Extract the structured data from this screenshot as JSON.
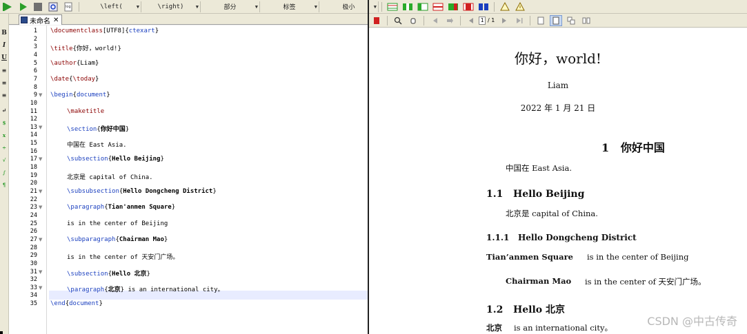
{
  "toolbar": {
    "dropdowns": [
      "\\left(",
      "\\right)",
      "部分",
      "标签",
      "极小"
    ]
  },
  "editor": {
    "tab_label": "未命名 X",
    "tab_name": "未命名",
    "lines": [
      {
        "n": "1",
        "parts": [
          [
            "cmd",
            "\\documentclass"
          ],
          [
            "",
            "[UTF8]{"
          ],
          [
            "kw",
            "ctexart"
          ],
          [
            "",
            "}"
          ]
        ]
      },
      {
        "n": "2",
        "parts": []
      },
      {
        "n": "3",
        "parts": [
          [
            "cmd",
            "\\title"
          ],
          [
            "",
            "{你好，world!}"
          ]
        ]
      },
      {
        "n": "4",
        "parts": []
      },
      {
        "n": "5",
        "parts": [
          [
            "cmd",
            "\\author"
          ],
          [
            "",
            "{Liam}"
          ]
        ]
      },
      {
        "n": "6",
        "parts": []
      },
      {
        "n": "7",
        "parts": [
          [
            "cmd",
            "\\date"
          ],
          [
            "",
            "{"
          ],
          [
            "cmd",
            "\\today"
          ],
          [
            "",
            "}"
          ]
        ]
      },
      {
        "n": "8",
        "parts": []
      },
      {
        "n": "9",
        "fold": true,
        "parts": [
          [
            "kw",
            "\\begin"
          ],
          [
            "",
            "{"
          ],
          [
            "kw",
            "document"
          ],
          [
            "",
            "}"
          ]
        ]
      },
      {
        "n": "10",
        "parts": []
      },
      {
        "n": "11",
        "ind": true,
        "parts": [
          [
            "cmd",
            "\\maketitle"
          ]
        ]
      },
      {
        "n": "12",
        "parts": []
      },
      {
        "n": "13",
        "fold": true,
        "ind": true,
        "parts": [
          [
            "kw",
            "\\section"
          ],
          [
            "",
            "{"
          ],
          [
            "bold",
            "你好中国"
          ],
          [
            "",
            "}"
          ]
        ]
      },
      {
        "n": "14",
        "parts": []
      },
      {
        "n": "15",
        "ind": true,
        "parts": [
          [
            "",
            "中国在 East Asia."
          ]
        ]
      },
      {
        "n": "16",
        "parts": []
      },
      {
        "n": "17",
        "fold": true,
        "ind": true,
        "parts": [
          [
            "kw",
            "\\subsection"
          ],
          [
            "",
            "{"
          ],
          [
            "bold",
            "Hello Beijing"
          ],
          [
            "",
            "}"
          ]
        ]
      },
      {
        "n": "18",
        "parts": []
      },
      {
        "n": "19",
        "ind": true,
        "parts": [
          [
            "",
            "北京是 capital of China."
          ]
        ]
      },
      {
        "n": "20",
        "parts": []
      },
      {
        "n": "21",
        "fold": true,
        "ind": true,
        "parts": [
          [
            "kw",
            "\\subsubsection"
          ],
          [
            "",
            "{"
          ],
          [
            "bold",
            "Hello Dongcheng District"
          ],
          [
            "",
            "}"
          ]
        ]
      },
      {
        "n": "22",
        "parts": []
      },
      {
        "n": "23",
        "fold": true,
        "ind": true,
        "parts": [
          [
            "kw",
            "\\paragraph"
          ],
          [
            "",
            "{"
          ],
          [
            "bold",
            "Tian'anmen Square"
          ],
          [
            "",
            "}"
          ]
        ]
      },
      {
        "n": "24",
        "parts": []
      },
      {
        "n": "25",
        "ind": true,
        "parts": [
          [
            "",
            "is in the center of Beijing"
          ]
        ]
      },
      {
        "n": "26",
        "parts": []
      },
      {
        "n": "27",
        "fold": true,
        "ind": true,
        "parts": [
          [
            "kw",
            "\\subparagraph"
          ],
          [
            "",
            "{"
          ],
          [
            "bold",
            "Chairman Mao"
          ],
          [
            "",
            "}"
          ]
        ]
      },
      {
        "n": "28",
        "parts": []
      },
      {
        "n": "29",
        "ind": true,
        "parts": [
          [
            "",
            "is in the center of 天安门广场。"
          ]
        ]
      },
      {
        "n": "30",
        "parts": []
      },
      {
        "n": "31",
        "fold": true,
        "ind": true,
        "parts": [
          [
            "kw",
            "\\subsection"
          ],
          [
            "",
            "{"
          ],
          [
            "bold",
            "Hello 北京"
          ],
          [
            "",
            "}"
          ]
        ]
      },
      {
        "n": "32",
        "parts": []
      },
      {
        "n": "33",
        "fold": true,
        "ind": true,
        "parts": [
          [
            "kw",
            "\\paragraph"
          ],
          [
            "",
            "{"
          ],
          [
            "bold",
            "北京"
          ],
          [
            "",
            "} is an international city。"
          ]
        ]
      },
      {
        "n": "34",
        "parts": []
      },
      {
        "n": "35",
        "parts": [
          [
            "kw",
            "\\end"
          ],
          [
            "",
            "{"
          ],
          [
            "kw",
            "document"
          ],
          [
            "",
            "}"
          ]
        ]
      }
    ]
  },
  "viewer": {
    "page_current": "1",
    "page_total": "/ 1",
    "title": "你好，world!",
    "author": "Liam",
    "date": "2022 年 1 月 21 日",
    "section_num": "1",
    "section_title": "你好中国",
    "section_text": "中国在 East Asia.",
    "sub1_num": "1.1",
    "sub1_title": "Hello Beijing",
    "sub1_text": "北京是 capital of China.",
    "subsub_num": "1.1.1",
    "subsub_title": "Hello Dongcheng District",
    "para1_title": "Tian’anmen Square",
    "para1_text": "is in the center of Beijing",
    "subpara_title": "Chairman Mao",
    "subpara_text": "is in the center of 天安门广场。",
    "sub2_num": "1.2",
    "sub2_title": "Hello 北京",
    "para2_title": "北京",
    "para2_text": "is an international city。"
  },
  "watermark": "CSDN @中古传奇"
}
